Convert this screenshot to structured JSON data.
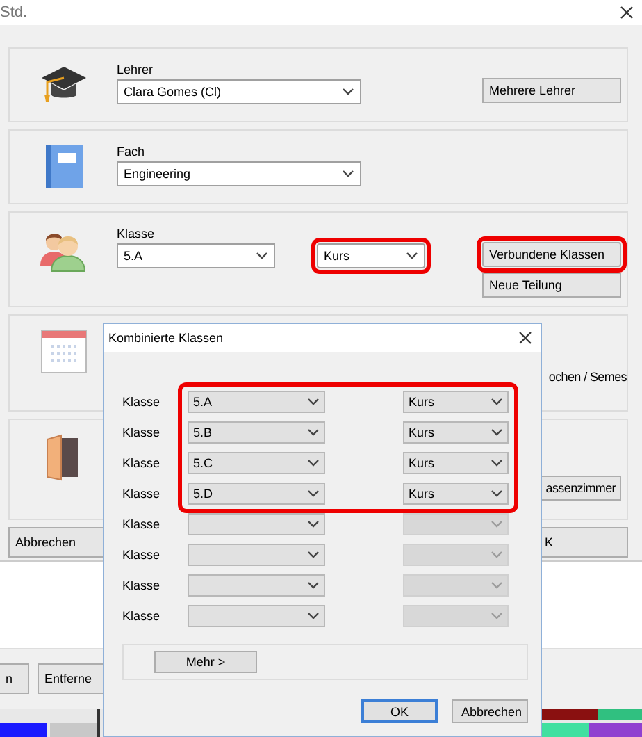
{
  "window": {
    "title": "Std."
  },
  "sections": [
    {
      "kind": "teacher",
      "label": "Lehrer",
      "field": {
        "value": "Clara Gomes (Cl)"
      },
      "buttons": [
        {
          "label": "Mehrere Lehrer",
          "highlighted": false
        }
      ]
    },
    {
      "kind": "subject",
      "label": "Fach",
      "field": {
        "value": "Engineering"
      }
    },
    {
      "kind": "class",
      "label": "Klasse",
      "field": {
        "value": "5.A"
      },
      "course_field": {
        "value": "Kurs",
        "highlighted": true
      },
      "buttons": [
        {
          "label": "Verbundene Klassen",
          "highlighted": true
        },
        {
          "label": "Neue Teilung",
          "highlighted": false
        }
      ]
    },
    {
      "kind": "calendar",
      "side_text": "ochen / Semes"
    },
    {
      "kind": "room",
      "buttons": [
        {
          "label": "assenzimmer",
          "highlighted": false
        }
      ]
    }
  ],
  "footer_buttons": [
    {
      "label": "Abbrechen"
    },
    {
      "label": "K"
    }
  ],
  "lower_buttons": [
    {
      "label": "n"
    },
    {
      "label": "Entferne"
    }
  ],
  "dialog": {
    "title": "Kombinierte Klassen",
    "rows": [
      {
        "label": "Klasse",
        "class": "5.A",
        "course": "Kurs",
        "course_disabled": false,
        "highlighted": true
      },
      {
        "label": "Klasse",
        "class": "5.B",
        "course": "Kurs",
        "course_disabled": false,
        "highlighted": true
      },
      {
        "label": "Klasse",
        "class": "5.C",
        "course": "Kurs",
        "course_disabled": false,
        "highlighted": true
      },
      {
        "label": "Klasse",
        "class": "5.D",
        "course": "Kurs",
        "course_disabled": false,
        "highlighted": true
      },
      {
        "label": "Klasse",
        "course_disabled": true,
        "highlighted": false
      },
      {
        "label": "Klasse",
        "course_disabled": true,
        "highlighted": false
      },
      {
        "label": "Klasse",
        "course_disabled": true,
        "highlighted": false
      },
      {
        "label": "Klasse",
        "course_disabled": true,
        "highlighted": false
      }
    ],
    "more_button": "Mehr >",
    "buttons": [
      {
        "label": "OK",
        "default": true
      },
      {
        "label": "Abbrechen",
        "default": false
      }
    ]
  }
}
